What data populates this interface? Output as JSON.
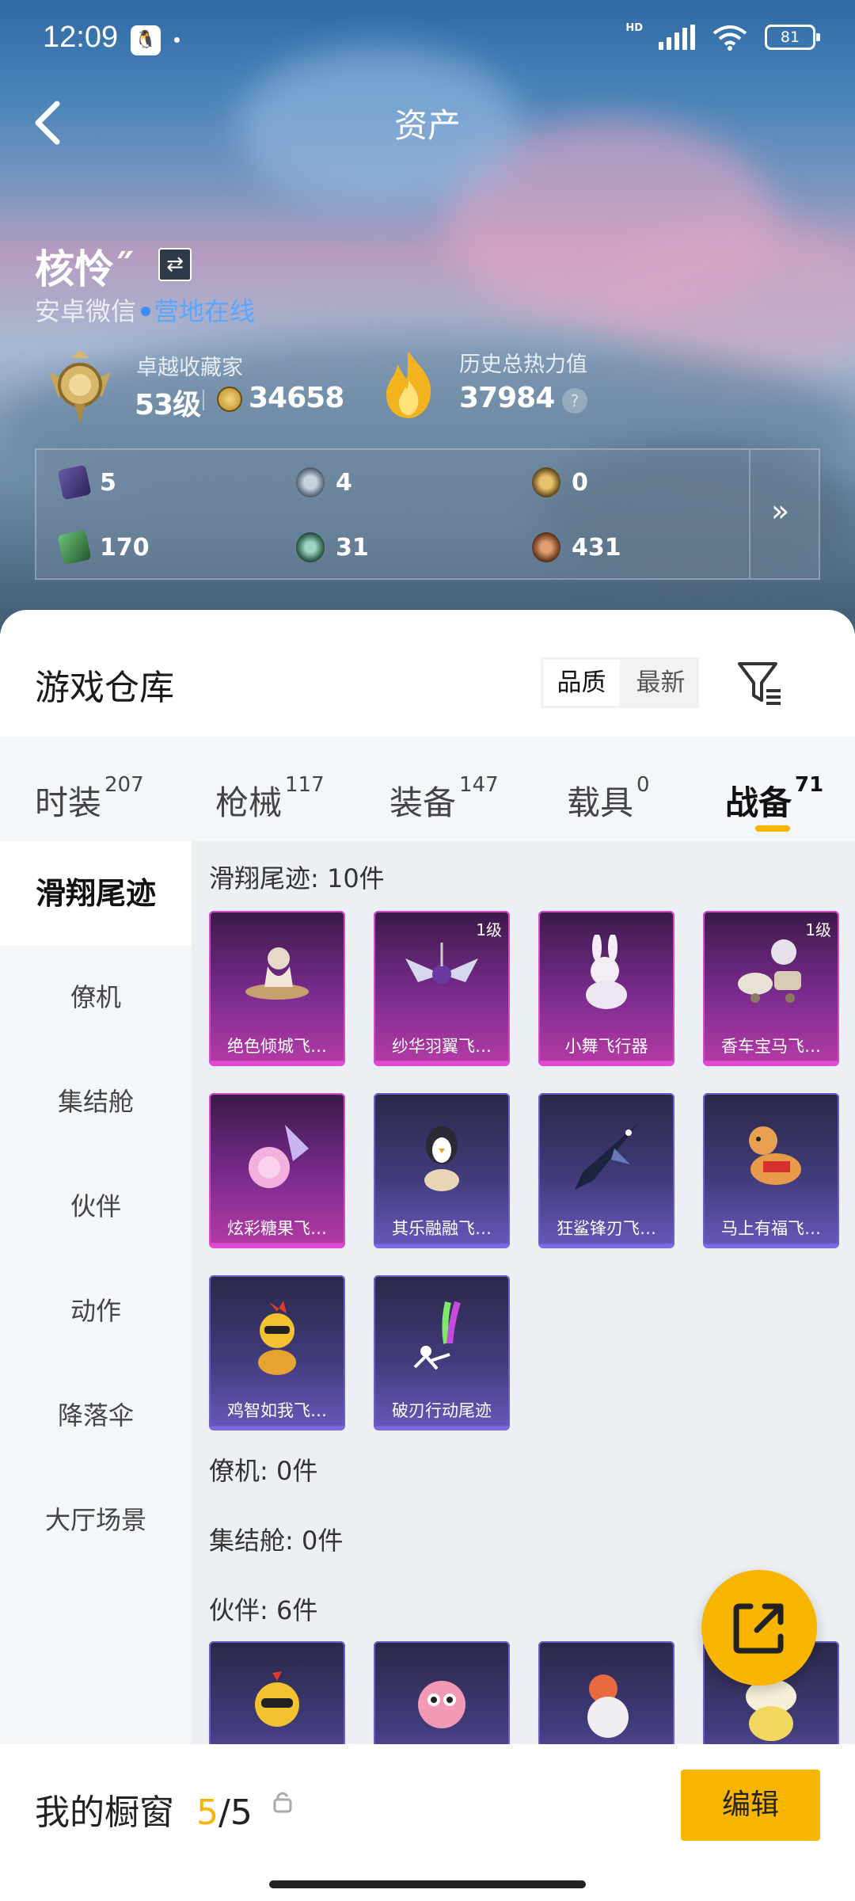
{
  "status_bar": {
    "time": "12:09",
    "network_label": "HD",
    "battery": "81"
  },
  "header": {
    "title": "资产"
  },
  "profile": {
    "name": "核怜˝",
    "platform": "安卓微信",
    "online_status": "营地在线",
    "rank_title": "卓越收藏家",
    "level": "53级",
    "coins": "34658",
    "heat_label": "历史总热力值",
    "heat_value": "37984",
    "help_icon": "?"
  },
  "resources": [
    {
      "icon": "purple-card-icon",
      "value": "5"
    },
    {
      "icon": "silver-medal-icon",
      "value": "4"
    },
    {
      "icon": "gold-medal-icon",
      "value": "0"
    },
    {
      "icon": "green-ticket-icon",
      "value": "170"
    },
    {
      "icon": "green-orb-icon",
      "value": "31"
    },
    {
      "icon": "bronze-orb-icon",
      "value": "431"
    }
  ],
  "resources_more": "»",
  "warehouse": {
    "title": "游戏仓库",
    "sort_options": [
      "品质",
      "最新"
    ],
    "sort_selected": "品质"
  },
  "tabs": [
    {
      "label": "时装",
      "count": "207"
    },
    {
      "label": "枪械",
      "count": "117"
    },
    {
      "label": "装备",
      "count": "147"
    },
    {
      "label": "载具",
      "count": "0"
    },
    {
      "label": "战备",
      "count": "71",
      "active": true
    }
  ],
  "sidebar": [
    "滑翔尾迹",
    "僚机",
    "集结舱",
    "伙伴",
    "动作",
    "降落伞",
    "大厅场景"
  ],
  "sections": {
    "glide": "滑翔尾迹: 10件",
    "wingman": "僚机: 0件",
    "pod": "集结舱: 0件",
    "partner": "伙伴: 6件"
  },
  "glide_items": [
    {
      "name": "绝色倾城飞…",
      "level": "",
      "rarity": "pink"
    },
    {
      "name": "纱华羽翼飞…",
      "level": "1级",
      "rarity": "pink"
    },
    {
      "name": "小舞飞行器",
      "level": "",
      "rarity": "pink"
    },
    {
      "name": "香车宝马飞…",
      "level": "1级",
      "rarity": "pink"
    },
    {
      "name": "炫彩糖果飞…",
      "level": "",
      "rarity": "pink"
    },
    {
      "name": "其乐融融飞…",
      "level": "",
      "rarity": "blue"
    },
    {
      "name": "狂鲨锋刃飞…",
      "level": "",
      "rarity": "blue"
    },
    {
      "name": "马上有福飞…",
      "level": "",
      "rarity": "blue"
    },
    {
      "name": "鸡智如我飞…",
      "level": "",
      "rarity": "blue"
    },
    {
      "name": "破刃行动尾迹",
      "level": "",
      "rarity": "blue"
    }
  ],
  "showcase": {
    "label": "我的橱窗",
    "current": "5",
    "separator": "/",
    "total": "5",
    "edit_label": "编辑"
  },
  "colors": {
    "accent": "#f7b500",
    "online": "#5aa7ff",
    "epic": "#b33aa5",
    "rare": "#6657b8"
  }
}
